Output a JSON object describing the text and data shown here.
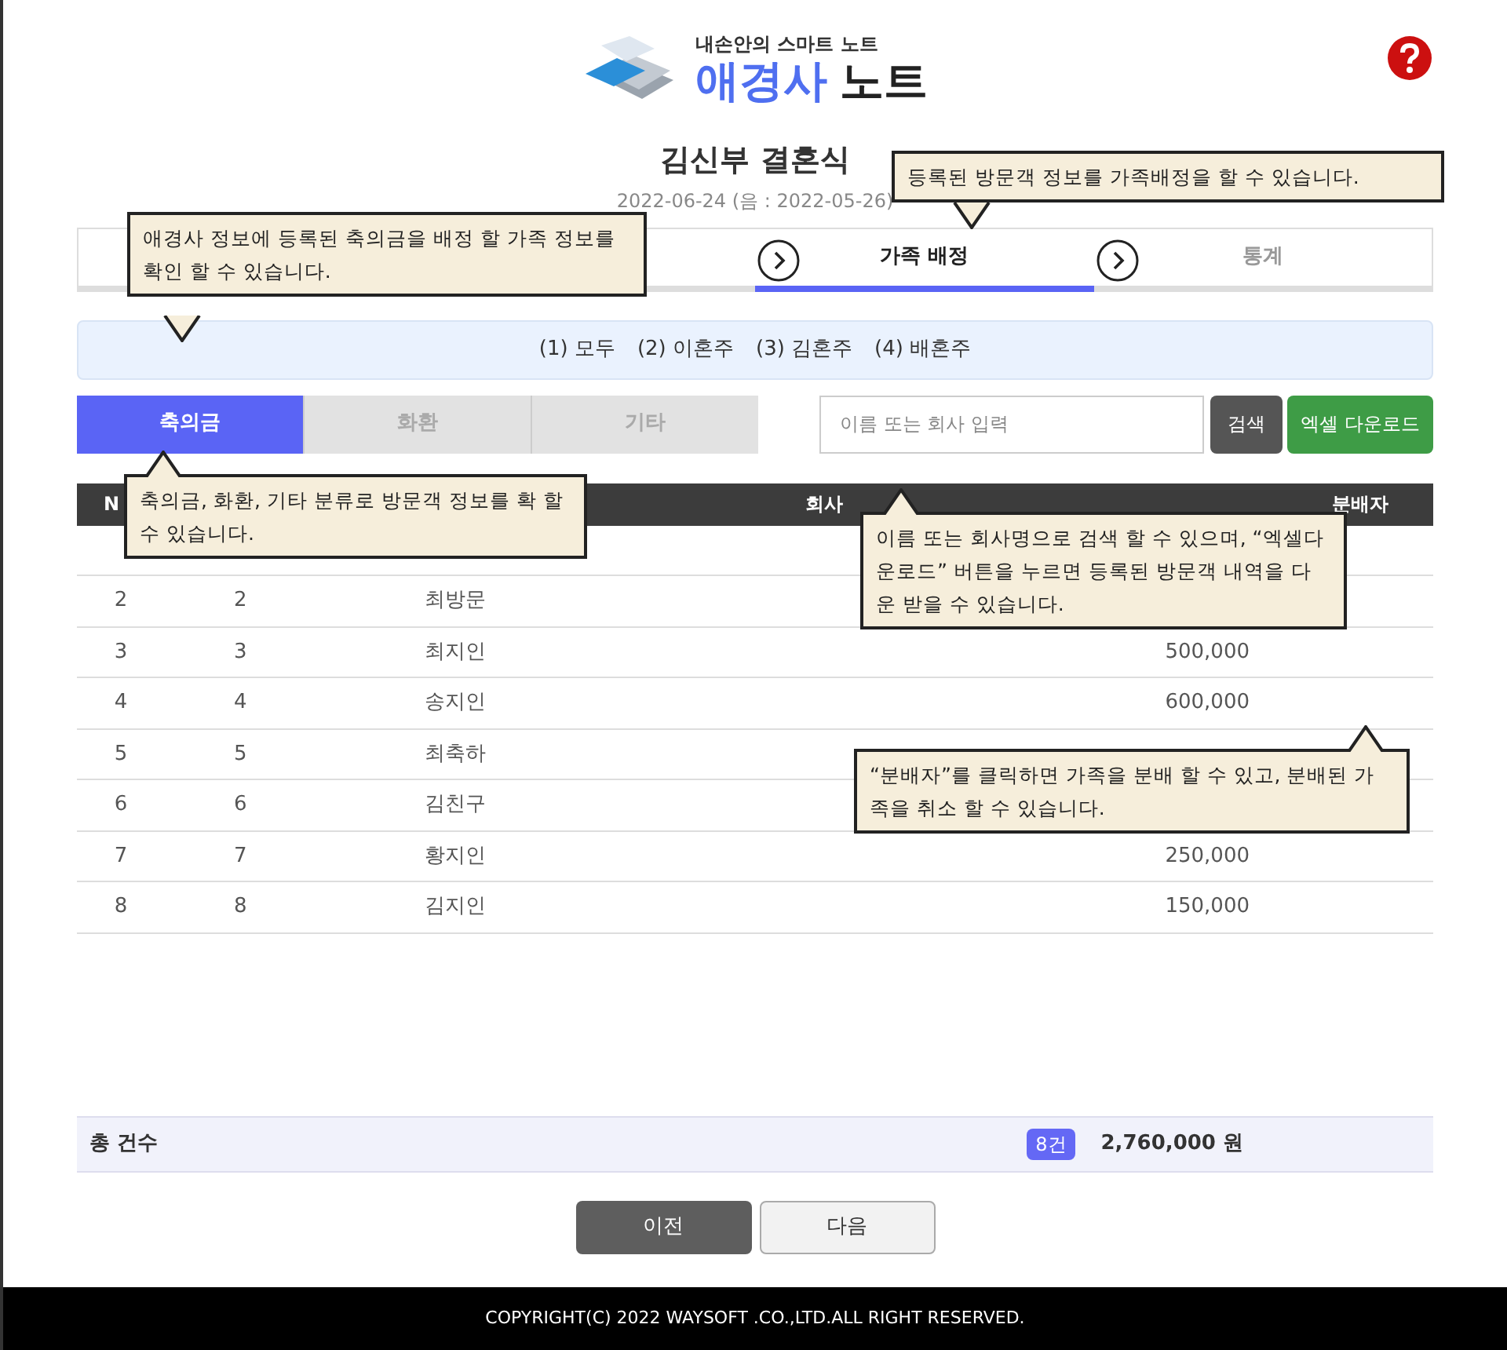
{
  "logo": {
    "tagline": "내손안의 스마트 노트",
    "brand": "애경사",
    "product": "노트"
  },
  "event": {
    "title": "김신부 결혼식",
    "date": "2022-06-24 (음 : 2022-05-26)"
  },
  "steps": [
    {
      "selected": false
    },
    {
      "selected": false
    },
    {
      "label": "가족 배정",
      "selected": true
    },
    {
      "label": "통계",
      "selected": false
    }
  ],
  "families": [
    "(1) 모두",
    "(2) 이혼주",
    "(3) 김혼주",
    "(4) 배혼주"
  ],
  "categories": [
    {
      "label": "축의금",
      "selected": true
    },
    {
      "label": "화환",
      "selected": false
    },
    {
      "label": "기타",
      "selected": false
    }
  ],
  "search": {
    "placeholder": "이름 또는 회사 입력",
    "button": "검색",
    "excel": "엑셀 다운로드"
  },
  "table": {
    "columns": [
      "N",
      "회사",
      "분배자"
    ],
    "rows": [
      {
        "no": "2",
        "seq": "2",
        "name": "최방문"
      },
      {
        "no": "3",
        "seq": "3",
        "name": "최지인",
        "amount": "500,000"
      },
      {
        "no": "4",
        "seq": "4",
        "name": "송지인",
        "amount": "600,000"
      },
      {
        "no": "5",
        "seq": "5",
        "name": "최축하"
      },
      {
        "no": "6",
        "seq": "6",
        "name": "김친구"
      },
      {
        "no": "7",
        "seq": "7",
        "name": "황지인",
        "amount": "250,000"
      },
      {
        "no": "8",
        "seq": "8",
        "name": "김지인",
        "amount": "150,000"
      }
    ]
  },
  "summary": {
    "label": "총 건수",
    "count": "8건",
    "total": "2,760,000 원"
  },
  "buttons": {
    "prev": "이전",
    "next": "다음"
  },
  "callouts": [
    {
      "text": "등록된 방문객 정보를 가족배정을 할 수 있습니다.",
      "kind": "down"
    },
    {
      "text": "애경사 정보에 등록된 축의금을 배정 할 가족 정보를 확인 할 수 있습니다.",
      "kind": "down"
    },
    {
      "text": "축의금, 화환, 기타 분류로 방문객 정보를 확 할 수 있습니다.",
      "kind": "up"
    },
    {
      "text": "이름 또는 회사명으로 검색 할 수 있으며, “엑셀다운로드” 버튼을 누르면 등록된 방문객 내역을 다운 받을 수 있습니다.",
      "kind": "up"
    },
    {
      "text": "“분배자”를 클릭하면 가족을 분배 할 수 있고, 분배된 가족을 취소 할 수 있습니다.",
      "kind": "up"
    }
  ],
  "footer": "COPYRIGHT(C) 2022 WAYSOFT .CO.,LTD.ALL RIGHT RESERVED."
}
